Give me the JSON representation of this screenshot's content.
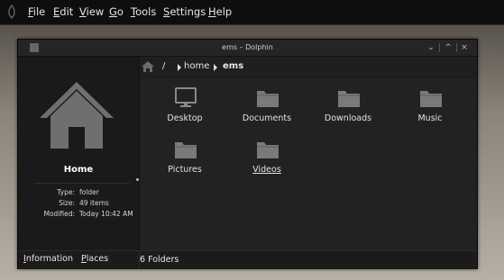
{
  "menubar": {
    "items": [
      {
        "key": "F",
        "rest": "ile"
      },
      {
        "key": "E",
        "rest": "dit"
      },
      {
        "key": "V",
        "rest": "iew"
      },
      {
        "key": "G",
        "rest": "o"
      },
      {
        "key": "T",
        "rest": "ools"
      },
      {
        "key": "S",
        "rest": "ettings"
      },
      {
        "key": "H",
        "rest": "elp"
      }
    ]
  },
  "window": {
    "title": "ems – Dolphin",
    "buttons": {
      "shade": "⌄",
      "maximize": "^",
      "close": "×"
    }
  },
  "breadcrumb": {
    "root": "/",
    "home": "home",
    "current": "ems"
  },
  "files": [
    {
      "name": "Desktop",
      "icon": "monitor-icon"
    },
    {
      "name": "Documents",
      "icon": "folder-icon"
    },
    {
      "name": "Downloads",
      "icon": "folder-icon"
    },
    {
      "name": "Music",
      "icon": "folder-icon"
    },
    {
      "name": "Pictures",
      "icon": "folder-icon"
    },
    {
      "name": "Videos",
      "icon": "folder-icon"
    }
  ],
  "info_panel": {
    "title": "Home",
    "rows": [
      {
        "key": "Type:",
        "value": "folder"
      },
      {
        "key": "Size:",
        "value": "49 items"
      },
      {
        "key": "Modified:",
        "value": "Today 10:42 AM"
      }
    ]
  },
  "bottom": {
    "tab_information": {
      "key": "I",
      "rest": "nformation"
    },
    "tab_places": {
      "key": "P",
      "rest": "laces"
    },
    "status": "6 Folders"
  },
  "colors": {
    "folder": "#7a7a7a",
    "window_bg": "#1e1e1e",
    "menubar_bg": "#0e0e0e"
  }
}
